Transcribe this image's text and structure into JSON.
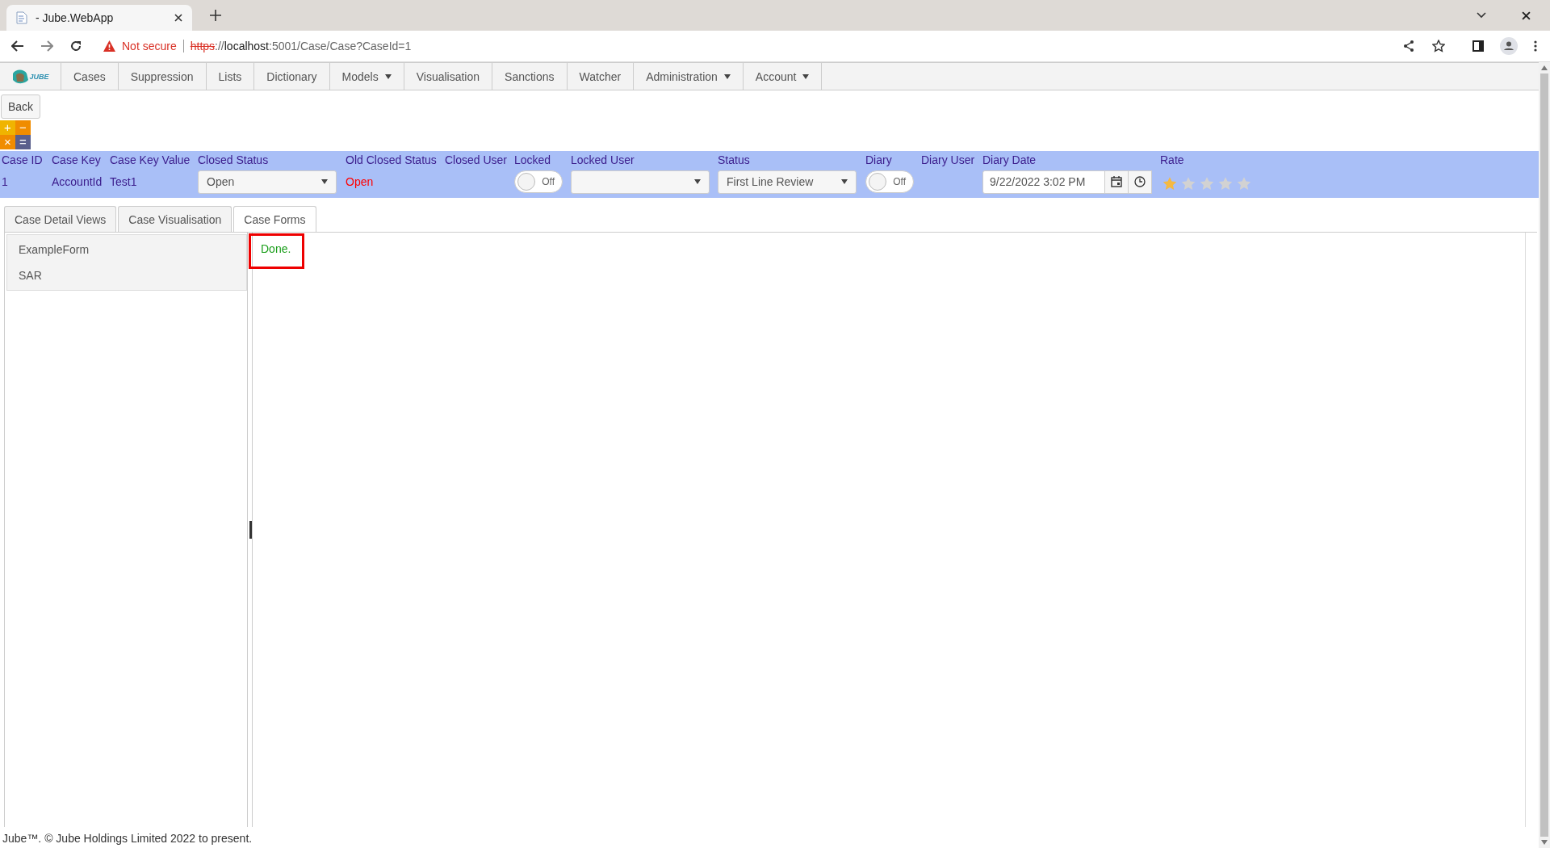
{
  "browser": {
    "tab_title": "- Jube.WebApp",
    "security": "Not secure",
    "url_scheme": "https",
    "url_sep": "://",
    "url_host": "localhost",
    "url_rest": ":5001/Case/Case?CaseId=1"
  },
  "nav": {
    "logo": "JUBE",
    "items": [
      {
        "label": "Cases",
        "dropdown": false
      },
      {
        "label": "Suppression",
        "dropdown": false
      },
      {
        "label": "Lists",
        "dropdown": false
      },
      {
        "label": "Dictionary",
        "dropdown": false
      },
      {
        "label": "Models",
        "dropdown": true
      },
      {
        "label": "Visualisation",
        "dropdown": false
      },
      {
        "label": "Sanctions",
        "dropdown": false
      },
      {
        "label": "Watcher",
        "dropdown": false
      },
      {
        "label": "Administration",
        "dropdown": true
      },
      {
        "label": "Account",
        "dropdown": true
      }
    ]
  },
  "back_button": "Back",
  "calculator": [
    "+",
    "−",
    "×",
    "="
  ],
  "case_header": [
    {
      "label": "Case ID",
      "kind": "text",
      "value": "1"
    },
    {
      "label": "Case Key",
      "kind": "text",
      "value": "AccountId"
    },
    {
      "label": "Case Key Value",
      "kind": "text",
      "value": "Test1"
    },
    {
      "label": "Closed Status",
      "kind": "select",
      "value": "Open"
    },
    {
      "label": "Old Closed Status",
      "kind": "alert",
      "value": "Open"
    },
    {
      "label": "Closed User",
      "kind": "empty"
    },
    {
      "label": "Locked",
      "kind": "toggle",
      "on": false,
      "value": "Off"
    },
    {
      "label": "Locked User",
      "kind": "select"
    },
    {
      "label": "Status",
      "kind": "select",
      "value": "First Line Review"
    },
    {
      "label": "Diary",
      "kind": "toggle",
      "on": false,
      "value": "Off"
    },
    {
      "label": "Diary User",
      "kind": "empty"
    },
    {
      "label": "Diary Date",
      "kind": "date",
      "value": "9/22/2022 3:02 PM"
    },
    {
      "label": "Rate",
      "kind": "stars",
      "stars": 1
    }
  ],
  "tabs": [
    {
      "label": "Case Detail Views",
      "selected": false
    },
    {
      "label": "Case Visualisation",
      "selected": false
    },
    {
      "label": "Case Forms",
      "selected": true
    }
  ],
  "forms": [
    "ExampleForm",
    "SAR"
  ],
  "status_message": {
    "text": "Done.",
    "highlighted": true
  },
  "footer": "Jube™. © Jube Holdings Limited 2022 to present."
}
